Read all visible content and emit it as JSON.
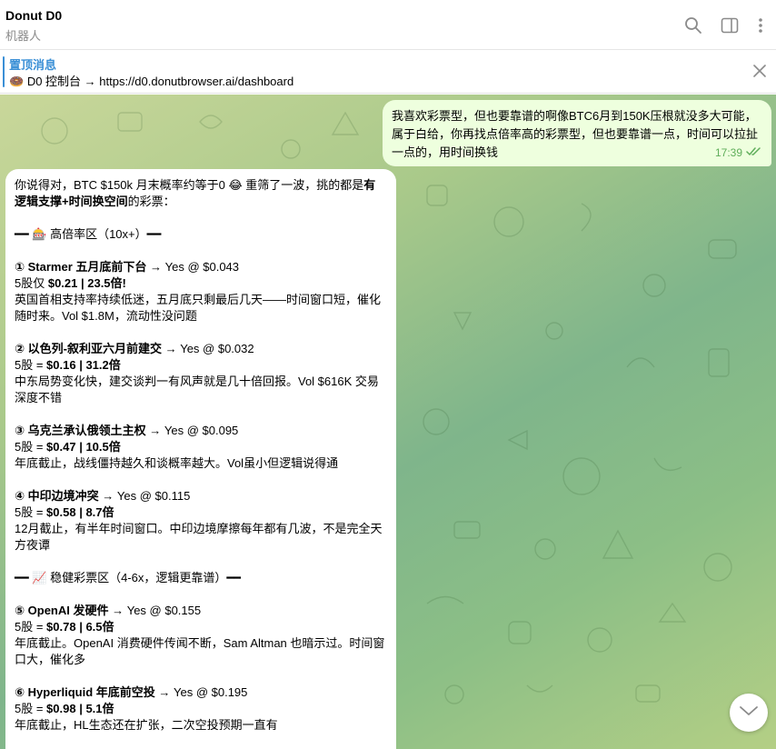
{
  "header": {
    "title": "Donut D0",
    "subtitle": "机器人"
  },
  "pinned": {
    "title": "置顶消息",
    "emoji": "🍩",
    "text": "D0 控制台 → https://d0.donutbrowser.ai/dashboard"
  },
  "outgoing": {
    "text": "我喜欢彩票型，但也要靠谱的啊像BTC6月到150K压根就没多大可能，属于白给，你再找点倍率高的彩票型，但也要靠谱一点，时间可以拉扯一点的，用时间换钱",
    "time": "17:39"
  },
  "incoming": {
    "intro_1": "你说得对，BTC $150k 月末概率约等于0 😂 重筛了一波，挑的都是",
    "intro_bold": "有逻辑支撑+时间换空间",
    "intro_2": "的彩票：",
    "section1": "━━ 🎰 高倍率区（10x+）━━",
    "items1": [
      {
        "num": "①",
        "name": "Starmer 五月底前下台",
        "price": "→ Yes @ $0.043",
        "detail_a": "5股仅 ",
        "detail_b": "$0.21 | 23.5倍!",
        "desc": "英国首相支持率持续低迷，五月底只剩最后几天——时间窗口短，催化随时来。Vol $1.8M，流动性没问题"
      },
      {
        "num": "②",
        "name": "以色列-叙利亚六月前建交",
        "price": "→ Yes @ $0.032",
        "detail_a": "5股 = ",
        "detail_b": "$0.16 | 31.2倍",
        "desc": "中东局势变化快，建交谈判一有风声就是几十倍回报。Vol $616K 交易深度不错"
      },
      {
        "num": "③",
        "name": "乌克兰承认俄领土主权",
        "price": "→ Yes @ $0.095",
        "detail_a": "5股 = ",
        "detail_b": "$0.47 | 10.5倍",
        "desc": "年底截止，战线僵持越久和谈概率越大。Vol虽小但逻辑说得通"
      },
      {
        "num": "④",
        "name": "中印边境冲突",
        "price": "→ Yes @ $0.115",
        "detail_a": "5股 = ",
        "detail_b": "$0.58 | 8.7倍",
        "desc": "12月截止，有半年时间窗口。中印边境摩擦每年都有几波，不是完全天方夜谭"
      }
    ],
    "section2": "━━ 📈 稳健彩票区（4-6x，逻辑更靠谱）━━",
    "items2": [
      {
        "num": "⑤",
        "name": "OpenAI 发硬件",
        "price": "→ Yes @ $0.155",
        "detail_a": "5股 = ",
        "detail_b": "$0.78 | 6.5倍",
        "desc": "年底截止。OpenAI 消费硬件传闻不断，Sam Altman 也暗示过。时间窗口大，催化多"
      },
      {
        "num": "⑥",
        "name": "Hyperliquid 年底前空投",
        "price": "→ Yes @ $0.195",
        "detail_a": "5股 = ",
        "detail_b": "$0.98 | 5.1倍",
        "desc": "年底截止，HL生态还在扩张，二次空投预期一直有"
      }
    ]
  },
  "colors": {
    "accent": "#3a8fd6",
    "outgoing_bubble": "#eeffde",
    "read_check": "#5fae5a"
  },
  "icons": [
    "search-icon",
    "sidebar-toggle-icon",
    "more-vertical-icon",
    "close-icon",
    "double-check-icon",
    "chevron-down-icon"
  ]
}
